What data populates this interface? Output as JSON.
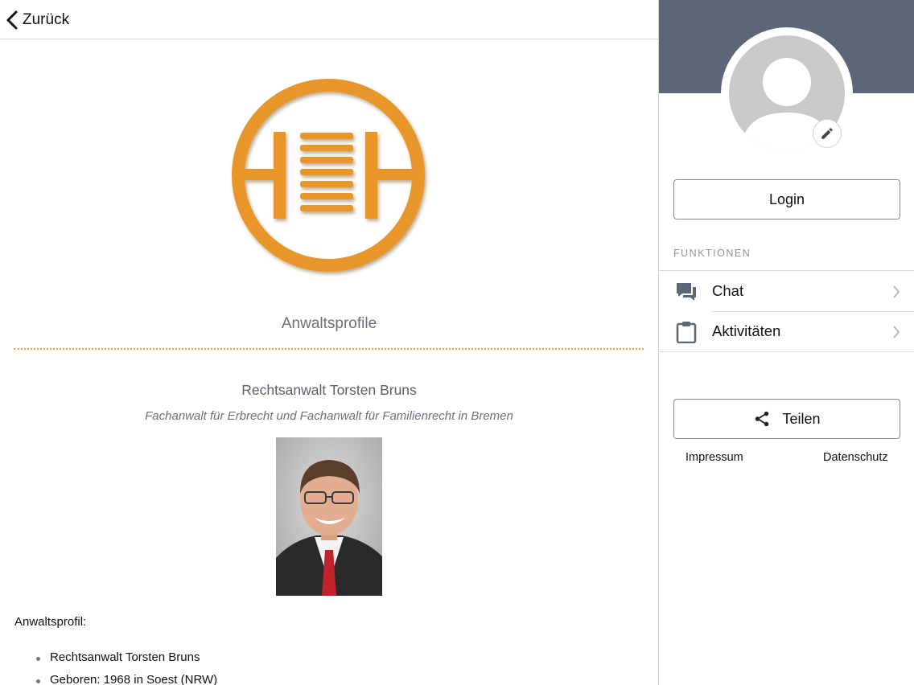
{
  "header": {
    "back_label": "Zurück"
  },
  "main": {
    "heading": "Anwaltsprofile",
    "lawyer_name": "Rechtsanwalt Torsten Bruns",
    "lawyer_subtitle": "Fachanwalt für Erbrecht und Fachanwalt für Familienrecht in Bremen",
    "profile_label": "Anwaltsprofil:",
    "bullets": [
      "Rechtsanwalt Torsten Bruns",
      "Geboren: 1968 in Soest (NRW)"
    ]
  },
  "sidebar": {
    "login_label": "Login",
    "section_title": "FUNKTIONEN",
    "menu": [
      {
        "label": "Chat",
        "icon": "chat-icon"
      },
      {
        "label": "Aktivitäten",
        "icon": "clipboard-icon"
      }
    ],
    "share_label": "Teilen",
    "footer": {
      "impressum": "Impressum",
      "datenschutz": "Datenschutz"
    }
  },
  "colors": {
    "banner": "#5d6678",
    "accent_orange": "#e3a233",
    "logo_orange": "#e8962a"
  }
}
